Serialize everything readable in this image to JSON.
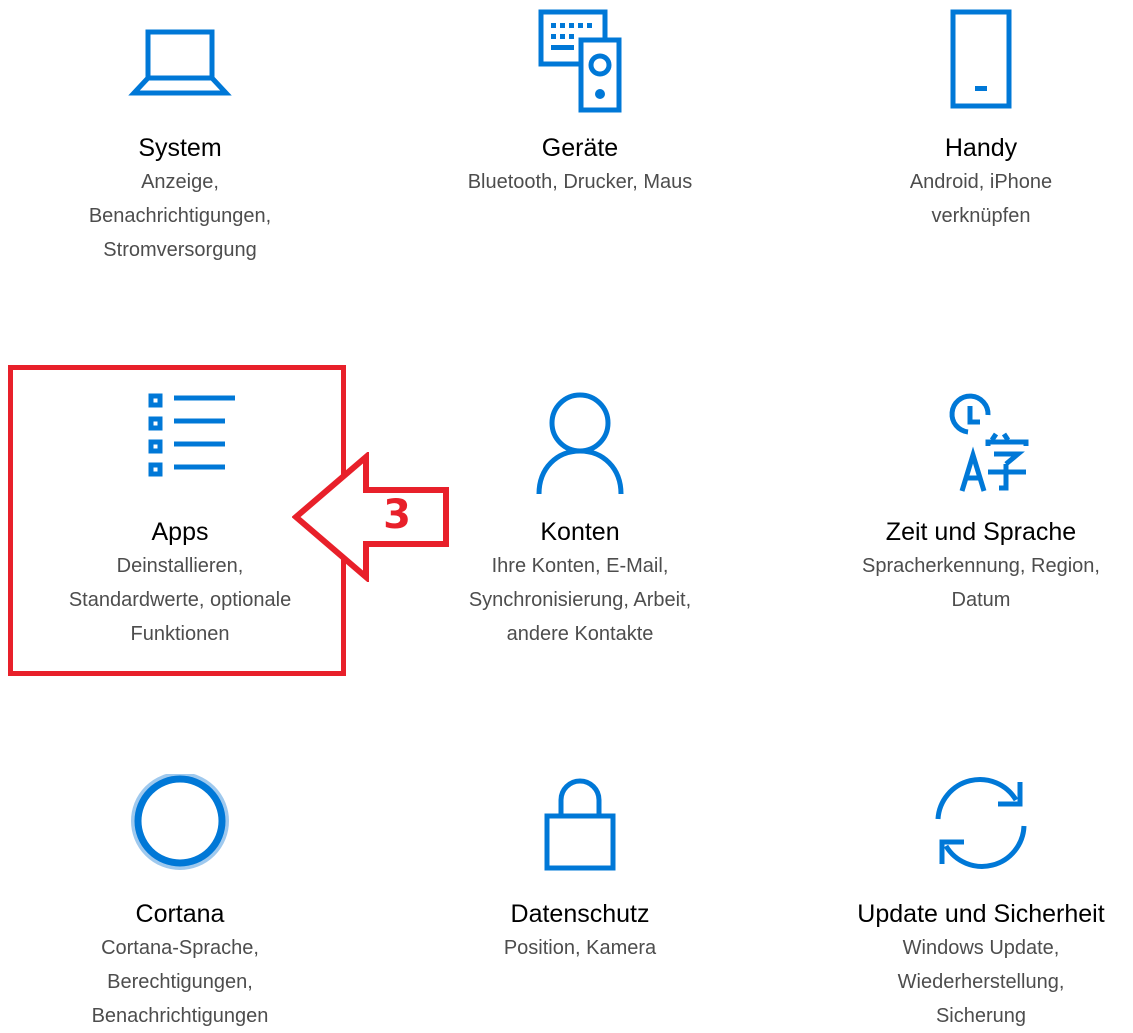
{
  "colors": {
    "accent": "#0078d7",
    "annotation": "#e8202a",
    "title_text": "#000000",
    "description_text": "#4d4d4d"
  },
  "tiles": [
    {
      "icon": "laptop-icon",
      "title": "System",
      "description": [
        "Anzeige,",
        "Benachrichtigungen,",
        "Stromversorgung"
      ]
    },
    {
      "icon": "devices-icon",
      "title": "Geräte",
      "description": [
        "Bluetooth, Drucker, Maus"
      ]
    },
    {
      "icon": "phone-icon",
      "title": "Handy",
      "description": [
        "Android, iPhone",
        "verknüpfen"
      ]
    },
    {
      "icon": "apps-list-icon",
      "title": "Apps",
      "description": [
        "Deinstallieren,",
        "Standardwerte, optionale",
        "Funktionen"
      ]
    },
    {
      "icon": "person-icon",
      "title": "Konten",
      "description": [
        "Ihre Konten, E-Mail,",
        "Synchronisierung, Arbeit,",
        "andere Kontakte"
      ]
    },
    {
      "icon": "time-language-icon",
      "title": "Zeit und Sprache",
      "description": [
        "Spracherkennung, Region,",
        "Datum"
      ]
    },
    {
      "icon": "cortana-icon",
      "title": "Cortana",
      "description": [
        "Cortana-Sprache,",
        "Berechtigungen,",
        "Benachrichtigungen"
      ]
    },
    {
      "icon": "lock-icon",
      "title": "Datenschutz",
      "description": [
        "Position, Kamera"
      ]
    },
    {
      "icon": "sync-icon",
      "title": "Update und Sicherheit",
      "description": [
        "Windows Update,",
        "Wiederherstellung,",
        "Sicherung"
      ]
    }
  ],
  "annotation": {
    "step_number": "3"
  }
}
